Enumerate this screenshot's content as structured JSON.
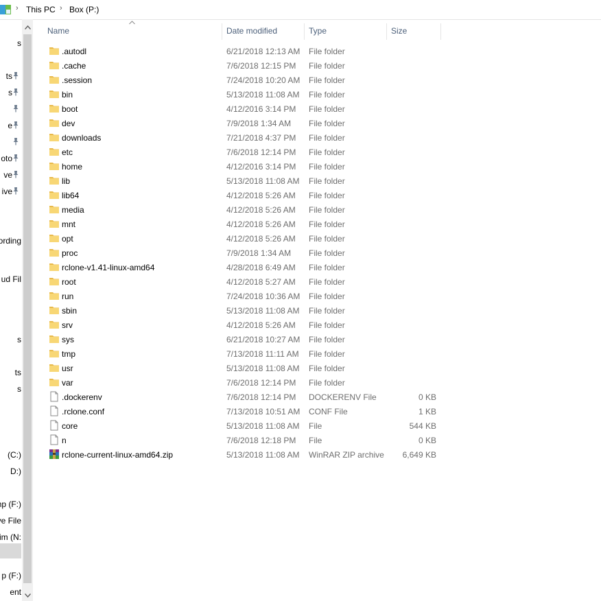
{
  "breadcrumb": [
    "This PC",
    "Box (P:)"
  ],
  "columns": {
    "name": "Name",
    "date": "Date modified",
    "type": "Type",
    "size": "Size"
  },
  "nav_items": [
    {
      "label": "s",
      "pinned": false
    },
    {
      "label": "ts",
      "pinned": true
    },
    {
      "label": "s",
      "pinned": true
    },
    {
      "label": "",
      "pinned": true
    },
    {
      "label": "e",
      "pinned": true
    },
    {
      "label": "",
      "pinned": true
    },
    {
      "label": "oto",
      "pinned": true
    },
    {
      "label": "ve",
      "pinned": true
    },
    {
      "label": "ive",
      "pinned": true
    },
    {
      "label": "ording",
      "pinned": false
    },
    {
      "label": "ud Fil",
      "pinned": false
    },
    {
      "label": "s",
      "pinned": false
    },
    {
      "label": "ts",
      "pinned": false
    },
    {
      "label": "s",
      "pinned": false
    },
    {
      "label": "(C:)",
      "pinned": false
    },
    {
      "label": "D:)",
      "pinned": false
    },
    {
      "label": "mp (F:)",
      "pinned": false
    },
    {
      "label": "ve File",
      "pinned": false
    },
    {
      "label": "im (N:",
      "pinned": false
    },
    {
      "label": "",
      "pinned": false,
      "selected": true
    },
    {
      "label": "p (F:)",
      "pinned": false
    },
    {
      "label": "ent",
      "pinned": false
    }
  ],
  "files": [
    {
      "name": ".autodl",
      "date": "6/21/2018 12:13 AM",
      "type": "File folder",
      "size": "",
      "icon": "folder-icon"
    },
    {
      "name": ".cache",
      "date": "7/6/2018 12:15 PM",
      "type": "File folder",
      "size": "",
      "icon": "folder-icon"
    },
    {
      "name": ".session",
      "date": "7/24/2018 10:20 AM",
      "type": "File folder",
      "size": "",
      "icon": "folder-icon"
    },
    {
      "name": "bin",
      "date": "5/13/2018 11:08 AM",
      "type": "File folder",
      "size": "",
      "icon": "folder-icon"
    },
    {
      "name": "boot",
      "date": "4/12/2016 3:14 PM",
      "type": "File folder",
      "size": "",
      "icon": "folder-icon"
    },
    {
      "name": "dev",
      "date": "7/9/2018 1:34 AM",
      "type": "File folder",
      "size": "",
      "icon": "folder-icon"
    },
    {
      "name": "downloads",
      "date": "7/21/2018 4:37 PM",
      "type": "File folder",
      "size": "",
      "icon": "folder-icon"
    },
    {
      "name": "etc",
      "date": "7/6/2018 12:14 PM",
      "type": "File folder",
      "size": "",
      "icon": "folder-icon"
    },
    {
      "name": "home",
      "date": "4/12/2016 3:14 PM",
      "type": "File folder",
      "size": "",
      "icon": "folder-icon"
    },
    {
      "name": "lib",
      "date": "5/13/2018 11:08 AM",
      "type": "File folder",
      "size": "",
      "icon": "folder-icon"
    },
    {
      "name": "lib64",
      "date": "4/12/2018 5:26 AM",
      "type": "File folder",
      "size": "",
      "icon": "folder-icon"
    },
    {
      "name": "media",
      "date": "4/12/2018 5:26 AM",
      "type": "File folder",
      "size": "",
      "icon": "folder-icon"
    },
    {
      "name": "mnt",
      "date": "4/12/2018 5:26 AM",
      "type": "File folder",
      "size": "",
      "icon": "folder-icon"
    },
    {
      "name": "opt",
      "date": "4/12/2018 5:26 AM",
      "type": "File folder",
      "size": "",
      "icon": "folder-icon"
    },
    {
      "name": "proc",
      "date": "7/9/2018 1:34 AM",
      "type": "File folder",
      "size": "",
      "icon": "folder-icon"
    },
    {
      "name": "rclone-v1.41-linux-amd64",
      "date": "4/28/2018 6:49 AM",
      "type": "File folder",
      "size": "",
      "icon": "folder-icon"
    },
    {
      "name": "root",
      "date": "4/12/2018 5:27 AM",
      "type": "File folder",
      "size": "",
      "icon": "folder-icon"
    },
    {
      "name": "run",
      "date": "7/24/2018 10:36 AM",
      "type": "File folder",
      "size": "",
      "icon": "folder-icon"
    },
    {
      "name": "sbin",
      "date": "5/13/2018 11:08 AM",
      "type": "File folder",
      "size": "",
      "icon": "folder-icon"
    },
    {
      "name": "srv",
      "date": "4/12/2018 5:26 AM",
      "type": "File folder",
      "size": "",
      "icon": "folder-icon"
    },
    {
      "name": "sys",
      "date": "6/21/2018 10:27 AM",
      "type": "File folder",
      "size": "",
      "icon": "folder-icon"
    },
    {
      "name": "tmp",
      "date": "7/13/2018 11:11 AM",
      "type": "File folder",
      "size": "",
      "icon": "folder-icon"
    },
    {
      "name": "usr",
      "date": "5/13/2018 11:08 AM",
      "type": "File folder",
      "size": "",
      "icon": "folder-icon"
    },
    {
      "name": "var",
      "date": "7/6/2018 12:14 PM",
      "type": "File folder",
      "size": "",
      "icon": "folder-icon"
    },
    {
      "name": ".dockerenv",
      "date": "7/6/2018 12:14 PM",
      "type": "DOCKERENV File",
      "size": "0 KB",
      "icon": "file-icon"
    },
    {
      "name": ".rclone.conf",
      "date": "7/13/2018 10:51 AM",
      "type": "CONF File",
      "size": "1 KB",
      "icon": "file-icon"
    },
    {
      "name": "core",
      "date": "5/13/2018 11:08 AM",
      "type": "File",
      "size": "544 KB",
      "icon": "file-icon"
    },
    {
      "name": "n",
      "date": "7/6/2018 12:18 PM",
      "type": "File",
      "size": "0 KB",
      "icon": "file-icon"
    },
    {
      "name": "rclone-current-linux-amd64.zip",
      "date": "5/13/2018 11:08 AM",
      "type": "WinRAR ZIP archive",
      "size": "6,649 KB",
      "icon": "winrar-archive-icon"
    }
  ],
  "colors": {
    "folder": "#f8d775",
    "folder_dark": "#e8b94a",
    "header_text": "#4c607a",
    "meta_text": "#6d6d6d"
  }
}
